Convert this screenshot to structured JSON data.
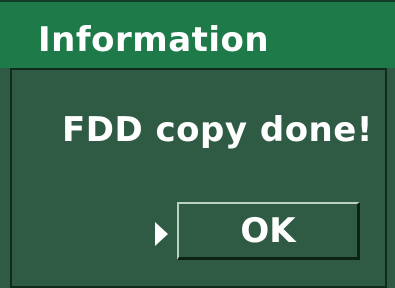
{
  "dialog": {
    "title": "Information",
    "message": "FDD copy done!",
    "ok_label": "OK",
    "focus_icon": "triangle-right-icon"
  },
  "colors": {
    "titlebar": "#1f7a4a",
    "body": "#2f5a43",
    "text": "#ffffff"
  }
}
